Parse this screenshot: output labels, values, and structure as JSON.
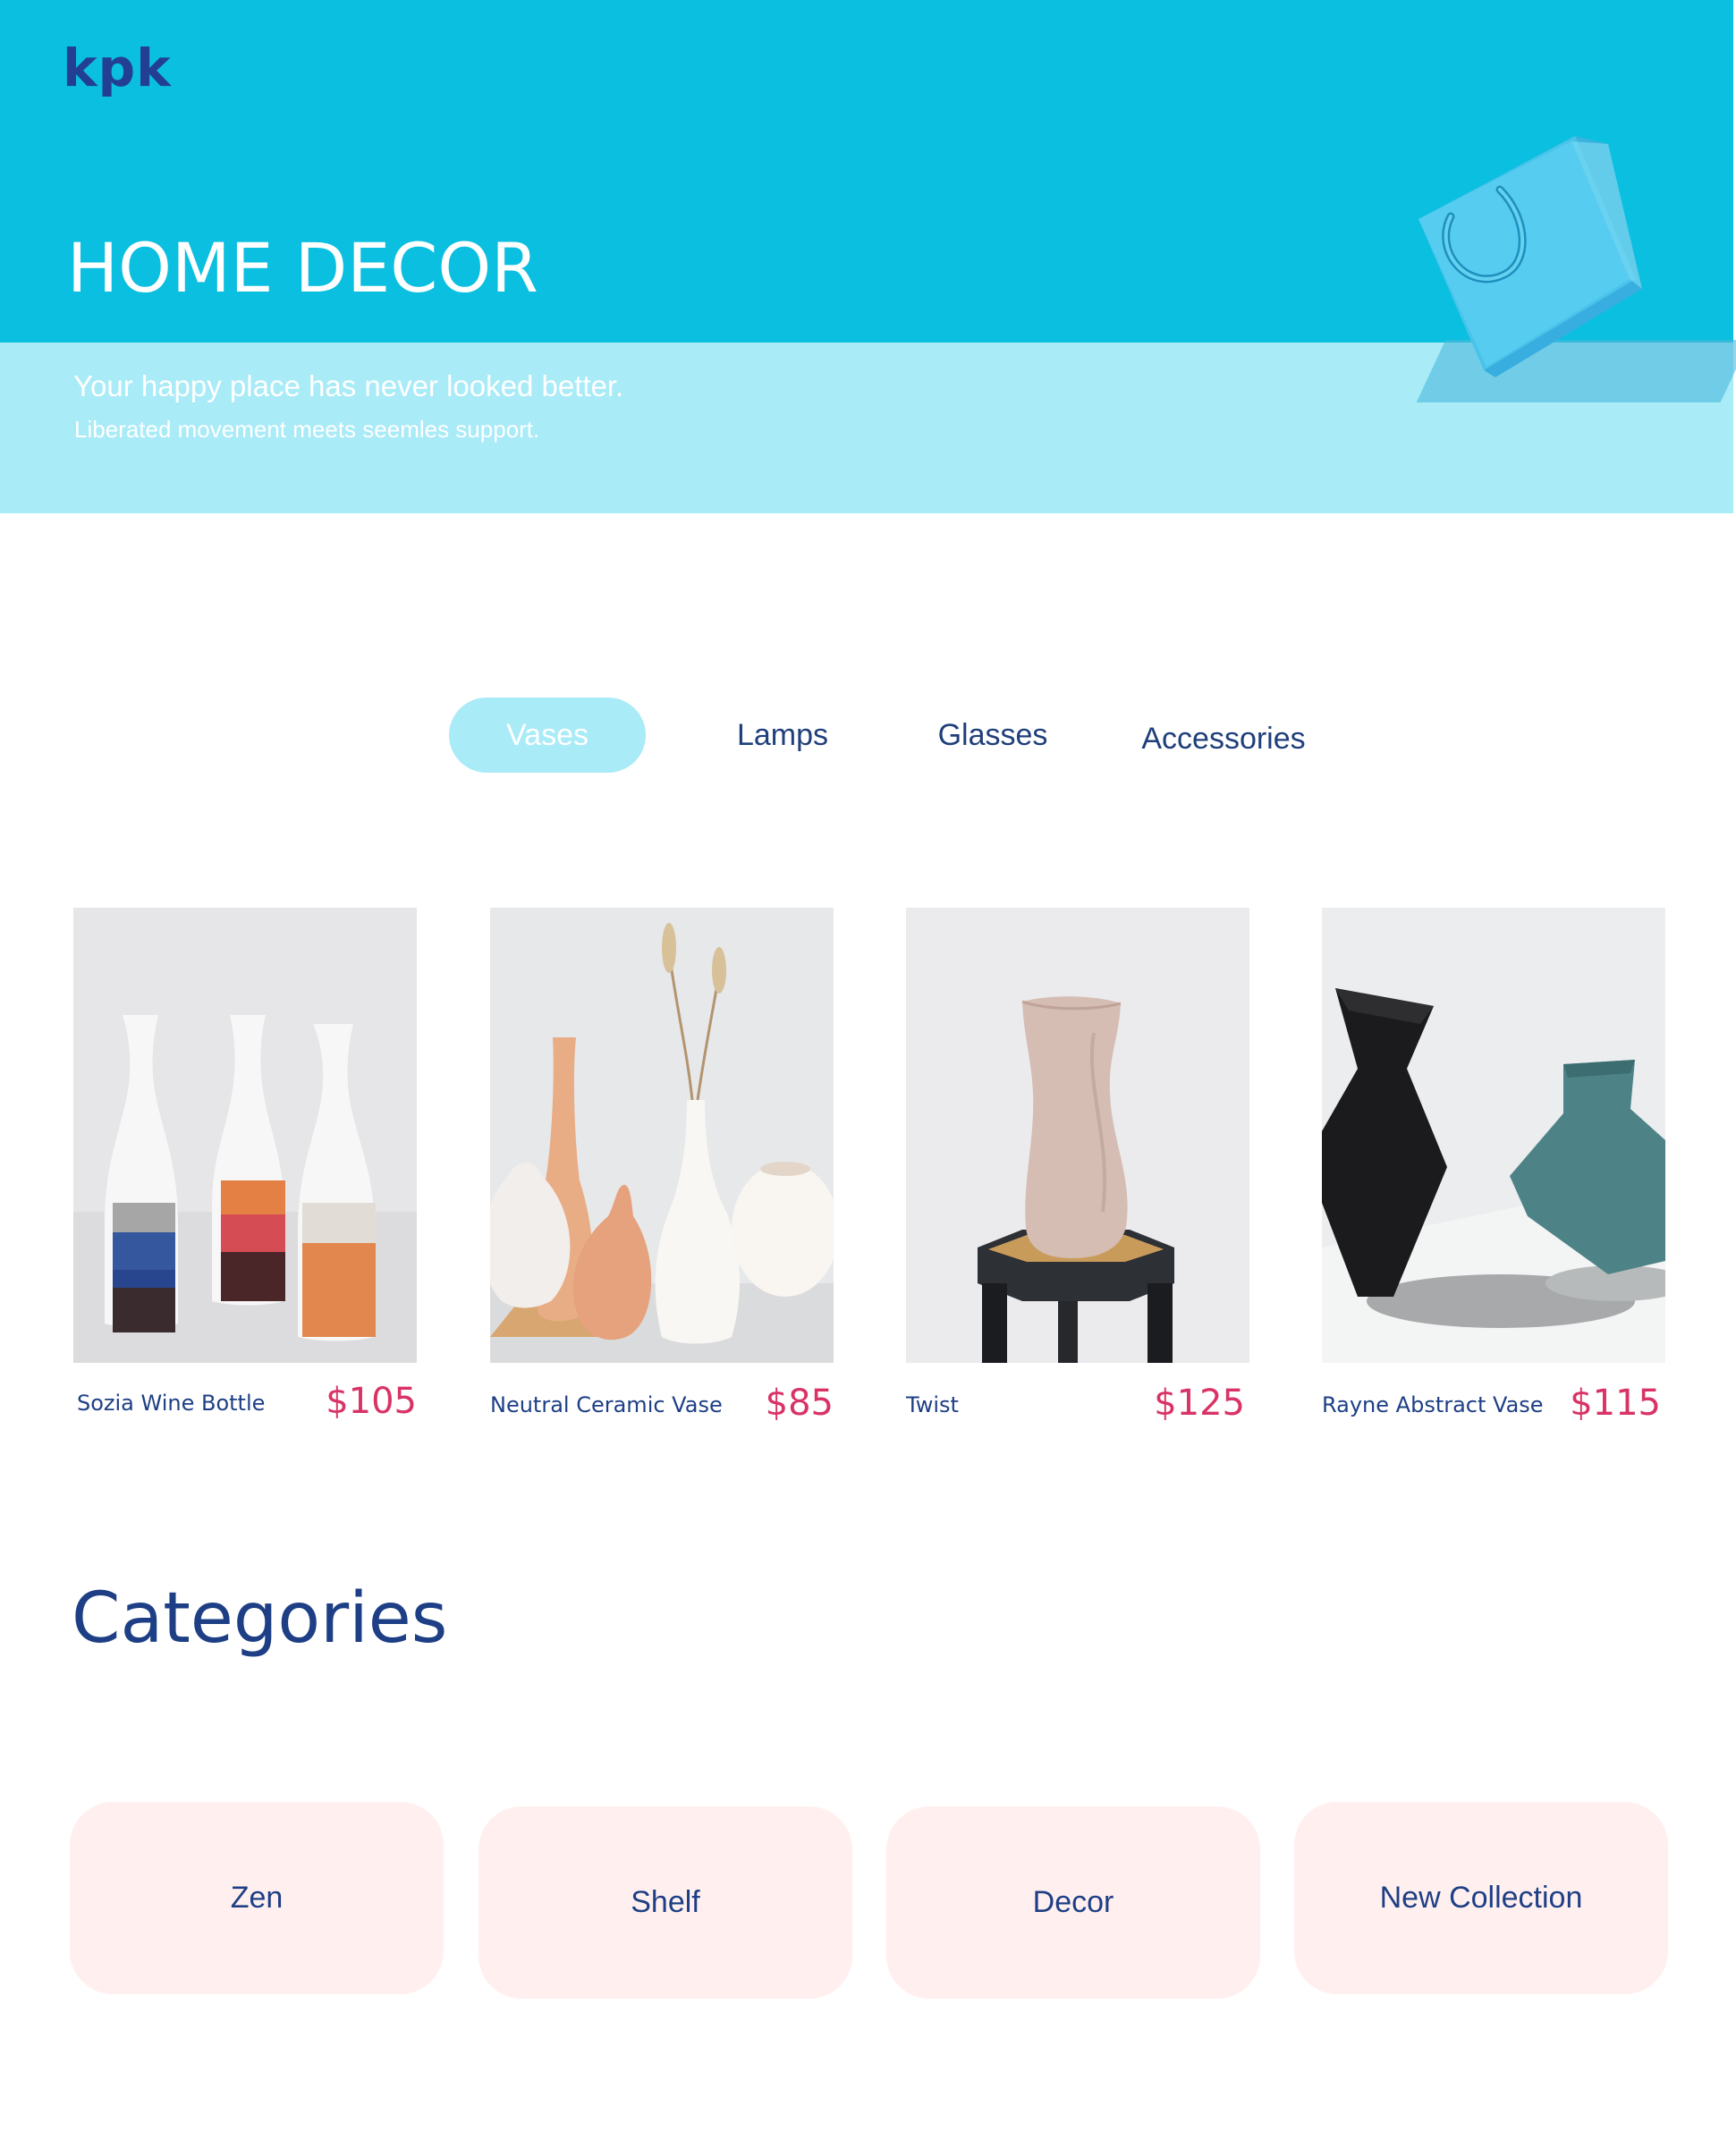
{
  "brand": {
    "logo_text": "kpk"
  },
  "hero": {
    "title": "HOME DECOR",
    "subtitle": "Your happy place has never looked better.",
    "tagline": "Liberated movement meets seemles support.",
    "colors": {
      "top": "#0abfdf",
      "bottom": "#a9ebf7"
    }
  },
  "tabs": [
    {
      "label": "Vases",
      "active": true
    },
    {
      "label": "Lamps",
      "active": false
    },
    {
      "label": "Glasses",
      "active": false
    },
    {
      "label": "Accessories",
      "active": false
    }
  ],
  "products": [
    {
      "name": "Sozia Wine Bottle",
      "price": "$105",
      "image": "striped-bottle-vases"
    },
    {
      "name": "Neutral Ceramic Vase",
      "price": "$85",
      "image": "neutral-ceramic-vases"
    },
    {
      "name": "Twist",
      "price": "$125",
      "image": "twist-vase-on-stool"
    },
    {
      "name": "Rayne Abstract Vase",
      "price": "$115",
      "image": "abstract-black-teal-vases"
    }
  ],
  "categories": {
    "title": "Categories",
    "items": [
      {
        "label": "Zen"
      },
      {
        "label": "Shelf"
      },
      {
        "label": "Decor"
      },
      {
        "label": "New Collection"
      }
    ]
  },
  "accent_colors": {
    "navy": "#1e3f85",
    "price": "#d93366",
    "card": "#fff0ef"
  }
}
